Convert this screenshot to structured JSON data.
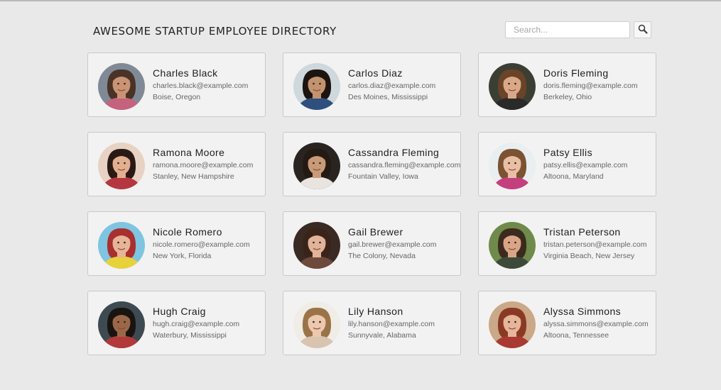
{
  "header": {
    "title": "AWESOME STARTUP EMPLOYEE DIRECTORY",
    "search_placeholder": "Search...",
    "search_icon": "magnifier-icon"
  },
  "employees": [
    {
      "name": "Charles Black",
      "email": "charles.black@example.com",
      "location": "Boise, Oregon",
      "bg": "#7f8a96",
      "skin": "#c89474",
      "hair": "#4a3226",
      "shirt": "#c5627e"
    },
    {
      "name": "Carlos Diaz",
      "email": "carlos.diaz@example.com",
      "location": "Des Moines, Mississippi",
      "bg": "#cfd8dc",
      "skin": "#c2936f",
      "hair": "#1b1410",
      "shirt": "#2f4f7f"
    },
    {
      "name": "Doris Fleming",
      "email": "doris.fleming@example.com",
      "location": "Berkeley, Ohio",
      "bg": "#3b3f33",
      "skin": "#d8a888",
      "hair": "#6b4328",
      "shirt": "#2a2a2a"
    },
    {
      "name": "Ramona Moore",
      "email": "ramona.moore@example.com",
      "location": "Stanley, New Hampshire",
      "bg": "#e8d2c4",
      "skin": "#e2b08f",
      "hair": "#2a1a16",
      "shirt": "#b4373f"
    },
    {
      "name": "Cassandra Fleming",
      "email": "cassandra.fleming@example.com",
      "location": "Fountain Valley, Iowa",
      "bg": "#2a2420",
      "skin": "#c99a78",
      "hair": "#241a14",
      "shirt": "#e9e4e0"
    },
    {
      "name": "Patsy Ellis",
      "email": "patsy.ellis@example.com",
      "location": "Altoona, Maryland",
      "bg": "#e9eef0",
      "skin": "#e9bfa4",
      "hair": "#7b5232",
      "shirt": "#c33f7e"
    },
    {
      "name": "Nicole Romero",
      "email": "nicole.romero@example.com",
      "location": "New York, Florida",
      "bg": "#7fc4e0",
      "skin": "#e7b497",
      "hair": "#a8302f",
      "shirt": "#e7d23b"
    },
    {
      "name": "Gail Brewer",
      "email": "gail.brewer@example.com",
      "location": "The Colony, Nevada",
      "bg": "#3a2a24",
      "skin": "#e1b398",
      "hair": "#3a241a",
      "shirt": "#6e4a3c"
    },
    {
      "name": "Tristan Peterson",
      "email": "tristan.peterson@example.com",
      "location": "Virginia Beach, New Jersey",
      "bg": "#6f8a4a",
      "skin": "#d9a586",
      "hair": "#3b2a1e",
      "shirt": "#3d4a3a"
    },
    {
      "name": "Hugh Craig",
      "email": "hugh.craig@example.com",
      "location": "Waterbury, Mississippi",
      "bg": "#3d4a52",
      "skin": "#9a6848",
      "hair": "#1a1410",
      "shirt": "#b23a3a"
    },
    {
      "name": "Lily Hanson",
      "email": "lily.hanson@example.com",
      "location": "Sunnyvale, Alabama",
      "bg": "#f0ece6",
      "skin": "#ecc8ae",
      "hair": "#9a7448",
      "shirt": "#d8c4b0"
    },
    {
      "name": "Alyssa Simmons",
      "email": "alyssa.simmons@example.com",
      "location": "Altoona, Tennessee",
      "bg": "#caa888",
      "skin": "#e7b59a",
      "hair": "#8a3a24",
      "shirt": "#a83a32"
    }
  ]
}
